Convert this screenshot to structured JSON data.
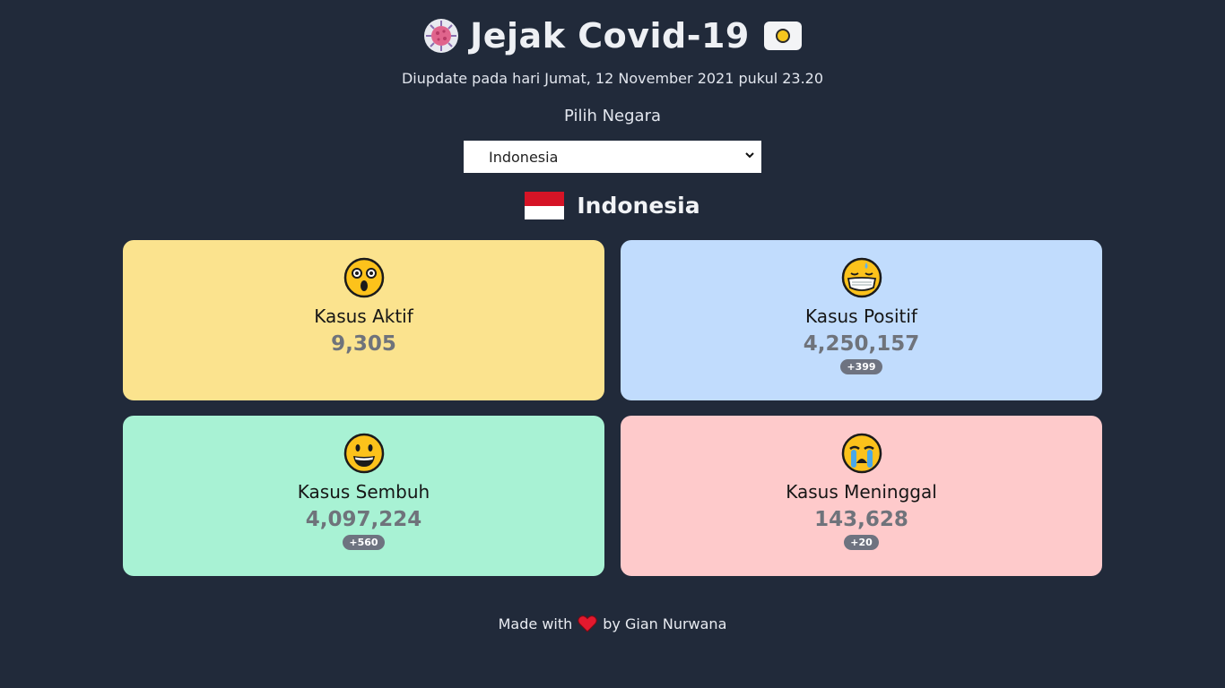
{
  "header": {
    "title": "Jejak Covid-19",
    "icon": "virus-icon",
    "theme_toggle_icon": "moon-icon"
  },
  "updated_text": "Diupdate pada hari Jumat, 12 November 2021 pukul 23.20",
  "picker": {
    "label": "Pilih Negara",
    "selected": "Indonesia"
  },
  "country": {
    "name": "Indonesia",
    "flag_icon": "indonesia-flag-icon"
  },
  "cards": {
    "aktif": {
      "label": "Kasus Aktif",
      "value": "9,305",
      "emoji": "astonished-face-icon",
      "color": "#fbe38e"
    },
    "positif": {
      "label": "Kasus Positif",
      "value": "4,250,157",
      "delta": "+399",
      "emoji": "mask-face-icon",
      "color": "#c1dcfd"
    },
    "sembuh": {
      "label": "Kasus Sembuh",
      "value": "4,097,224",
      "delta": "+560",
      "emoji": "grinning-face-icon",
      "color": "#a8f2d4"
    },
    "meninggal": {
      "label": "Kasus Meninggal",
      "value": "143,628",
      "delta": "+20",
      "emoji": "crying-face-icon",
      "color": "#fecacb"
    }
  },
  "footer": {
    "prefix": "Made with",
    "suffix": "by Gian Nurwana",
    "icon": "heart-icon"
  }
}
